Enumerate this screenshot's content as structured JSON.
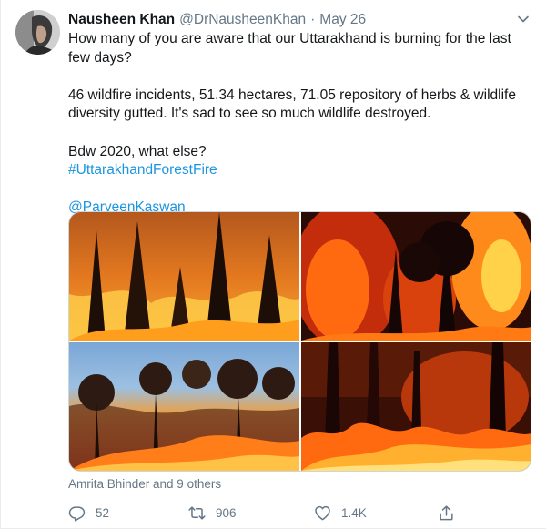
{
  "tweet": {
    "author_name": "Nausheen Khan",
    "handle": "@DrNausheenKhan",
    "separator": "·",
    "date": "May 26",
    "lines": [
      "How many of you are aware that our Uttarakhand is burning for the last",
      "few days?",
      "",
      "46 wildfire incidents, 51.34 hectares, 71.05 repository of herbs & wildlife",
      "diversity gutted. It's sad to see so much wildlife destroyed.",
      "",
      "Bdw 2020, what else?"
    ],
    "hashtag": "#UttarakhandForestFire",
    "mention": "@ParveenKaswan",
    "liked_by": "Amrita Bhinder and 9 others"
  },
  "actions": {
    "reply_count": "52",
    "retweet_count": "906",
    "like_count": "1.4K"
  },
  "icons": {
    "caret": "chevron-down-icon",
    "reply": "reply-icon",
    "retweet": "retweet-icon",
    "like": "heart-icon",
    "share": "share-icon"
  },
  "colors": {
    "text": "#14171a",
    "secondary": "#657786",
    "link": "#1b95e0",
    "border": "#e6ecf0"
  }
}
